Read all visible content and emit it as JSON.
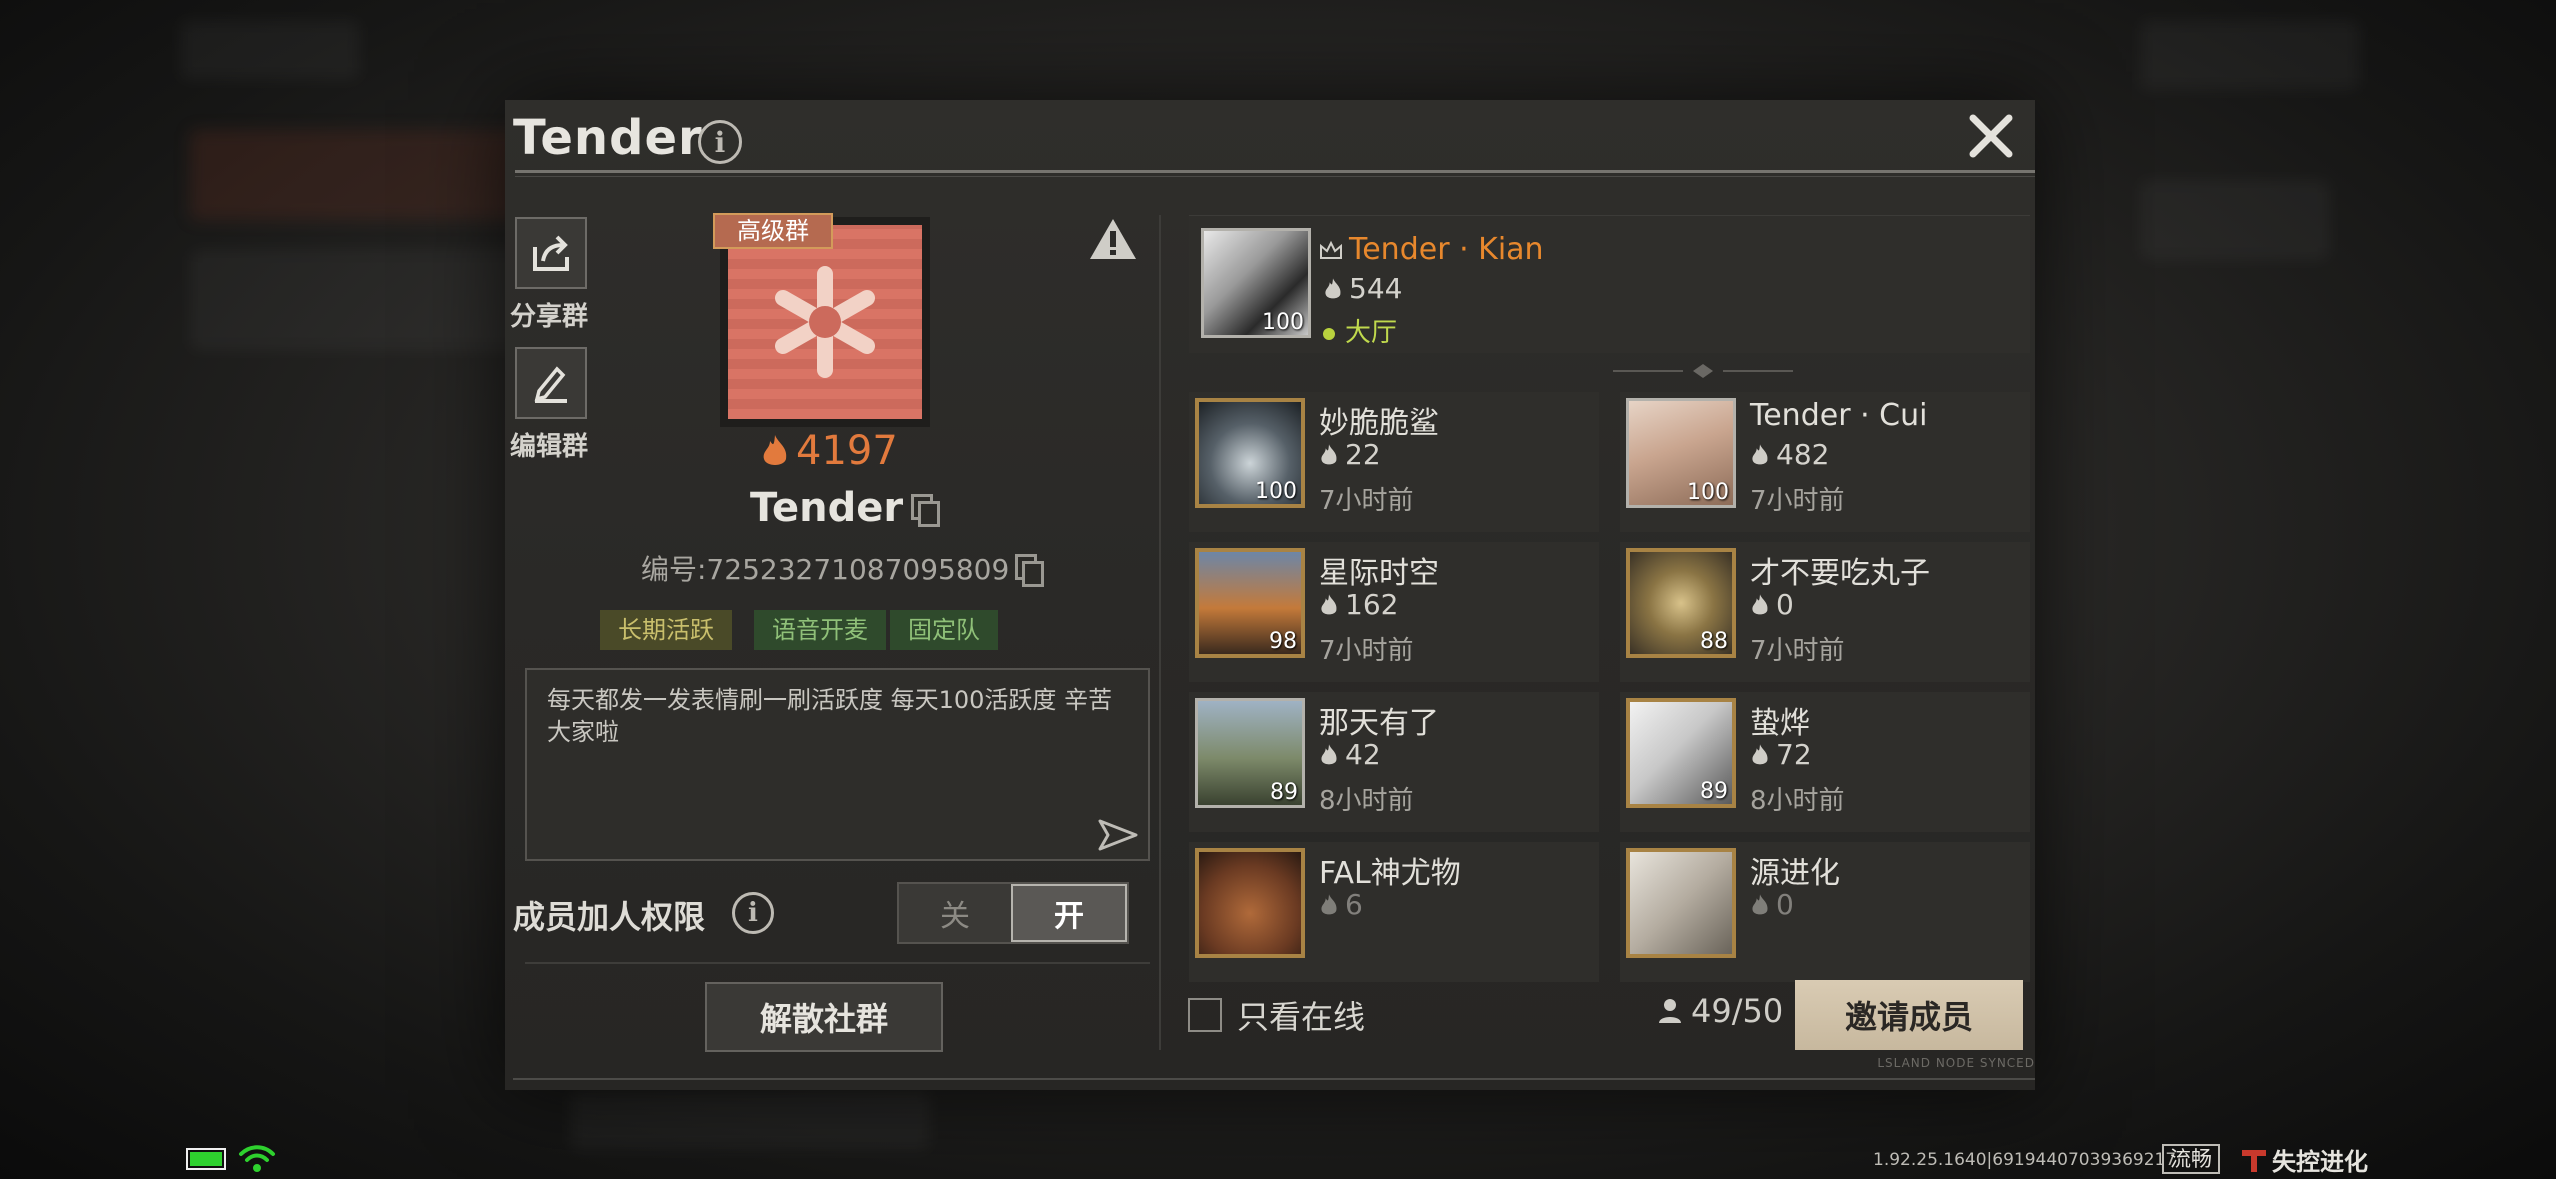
{
  "dialog": {
    "title": "Tender",
    "share_label": "分享群",
    "edit_label": "编辑群",
    "tier_tag": "高级群",
    "activity": "4197",
    "group_name": "Tender",
    "group_id": "编号:72523271087095809",
    "chips": [
      "长期活跃",
      "语音开麦",
      "固定队"
    ],
    "description": "每天都发一发表情刷一刷活跃度 每天100活跃度  辛苦大家啦",
    "permission_label": "成员加人权限",
    "toggle_off": "关",
    "toggle_on": "开",
    "disband_label": "解散社群"
  },
  "owner": {
    "name": "Tender · Kian",
    "activity": "544",
    "level": "100",
    "status": "大厅"
  },
  "members": [
    {
      "name": "妙脆脆鲨",
      "activity": "22",
      "level": "100",
      "status": "7小时前"
    },
    {
      "name": "Tender · Cui",
      "activity": "482",
      "level": "100",
      "status": "7小时前"
    },
    {
      "name": "星际时空",
      "activity": "162",
      "level": "98",
      "status": "7小时前"
    },
    {
      "name": "才不要吃丸子",
      "activity": "0",
      "level": "88",
      "status": "7小时前"
    },
    {
      "name": "那天有了",
      "activity": "42",
      "level": "89",
      "status": "8小时前"
    },
    {
      "name": "蛰烨",
      "activity": "72",
      "level": "89",
      "status": "8小时前"
    },
    {
      "name": "FAL神尤物",
      "activity": "6",
      "level": "",
      "status": ""
    },
    {
      "name": "源进化",
      "activity": "0",
      "level": "",
      "status": ""
    }
  ],
  "footer": {
    "online_only": "只看在线",
    "member_count": "49/50",
    "invite_label": "邀请成员",
    "tiny_text": "LSLAND NODE SYNCED"
  },
  "status_bar": {
    "version": "1.92.25.1640|6919440703936921​7",
    "quality": "流畅",
    "logo": "失控进化"
  },
  "colors": {
    "owner_name": "#e8882d",
    "activity": "#e27a3d",
    "online": "#b9d23e",
    "invite_btn": "#d3c5ad"
  }
}
